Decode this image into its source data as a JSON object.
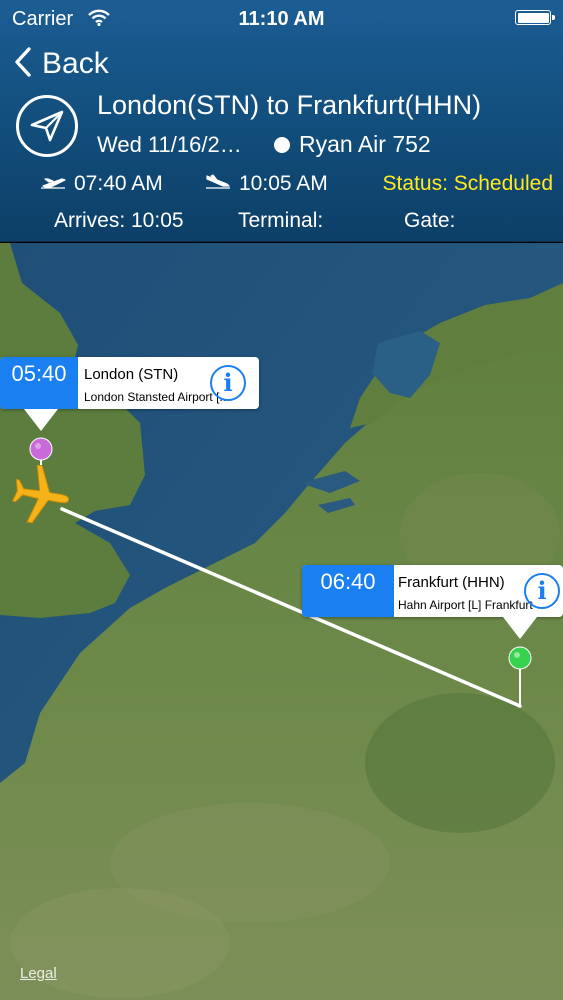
{
  "status_bar": {
    "carrier": "Carrier",
    "time": "11:10 AM"
  },
  "nav": {
    "back_label": "Back"
  },
  "flight": {
    "route": "London(STN) to Frankfurt(HHN)",
    "date": "Wed 11/16/2…",
    "airline": "Ryan Air 752",
    "departure_time": "07:40 AM",
    "arrival_time": "10:05 AM",
    "status": "Status: Scheduled",
    "arrives": "Arrives: 10:05",
    "terminal": "Terminal:",
    "gate": "Gate:"
  },
  "map": {
    "origin": {
      "time": "05:40",
      "name": "London (STN)",
      "airport": "London Stansted Airport [..."
    },
    "destination": {
      "time": "06:40",
      "name": "Frankfurt (HHN)",
      "airport": "Hahn Airport [L] Frankfurt"
    },
    "legal_label": "Legal"
  },
  "colors": {
    "header": "#13507f",
    "status": "#ffea1f",
    "callout_accent": "#1a7ff0",
    "origin_pin": "#c86ad8",
    "destination_pin": "#37d24e",
    "plane": "#f6b219"
  }
}
